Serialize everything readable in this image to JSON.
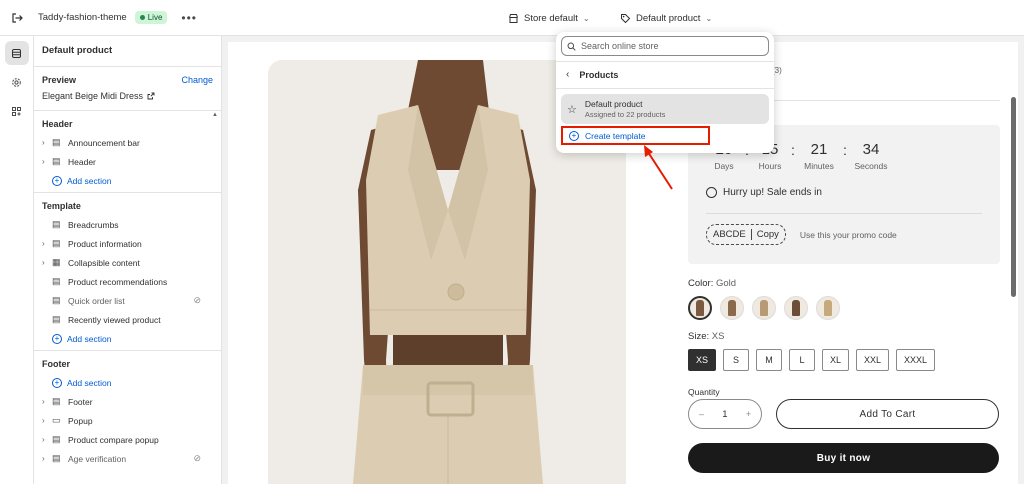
{
  "topbar": {
    "theme_name": "Taddy-fashion-theme",
    "live_label": "Live",
    "more_label": "•••",
    "store_label": "Store default",
    "template_label": "Default product"
  },
  "sidebar": {
    "title": "Default product",
    "preview": {
      "heading": "Preview",
      "change_label": "Change",
      "product": "Elegant Beige Midi Dress"
    },
    "header": {
      "heading": "Header",
      "items": [
        "Announcement bar",
        "Header"
      ],
      "add_label": "Add section"
    },
    "template": {
      "heading": "Template",
      "items": [
        {
          "label": "Breadcrumbs"
        },
        {
          "label": "Product information"
        },
        {
          "label": "Collapsible content"
        },
        {
          "label": "Product recommendations"
        },
        {
          "label": "Quick order list"
        },
        {
          "label": "Recently viewed product"
        }
      ],
      "add_label": "Add section"
    },
    "footer": {
      "heading": "Footer",
      "add_label": "Add section",
      "items": [
        "Footer",
        "Popup",
        "Product compare popup",
        "Age verification"
      ]
    }
  },
  "popover": {
    "search_placeholder": "Search online store",
    "back_label": "Products",
    "template_item": {
      "title": "Default product",
      "subtitle": "Assigned to 22 products"
    },
    "create_label": "Create template"
  },
  "product": {
    "partial_under_popover": "(3)",
    "countdown": [
      {
        "value": "20",
        "label": "Days"
      },
      {
        "value": "15",
        "label": "Hours"
      },
      {
        "value": "21",
        "label": "Minutes"
      },
      {
        "value": "34",
        "label": "Seconds"
      }
    ],
    "hurry_text": "Hurry up! Sale ends in",
    "promo_code": "ABCDE",
    "copy_label": "Copy",
    "promo_note": "Use this your promo code",
    "color_label": "Color:",
    "color_value": "Gold",
    "size_label": "Size:",
    "size_value": "XS",
    "sizes": [
      "XS",
      "S",
      "M",
      "L",
      "XL",
      "XXL",
      "XXXL"
    ],
    "quantity_label": "Quantity",
    "quantity_value": "1",
    "minus": "–",
    "plus": "+",
    "add_to_cart": "Add To Cart",
    "buy_now": "Buy it now"
  },
  "colors": {
    "accent_blue": "#005bd3",
    "annotation_red": "#e51c00",
    "live_green": "#cdf5d6"
  }
}
